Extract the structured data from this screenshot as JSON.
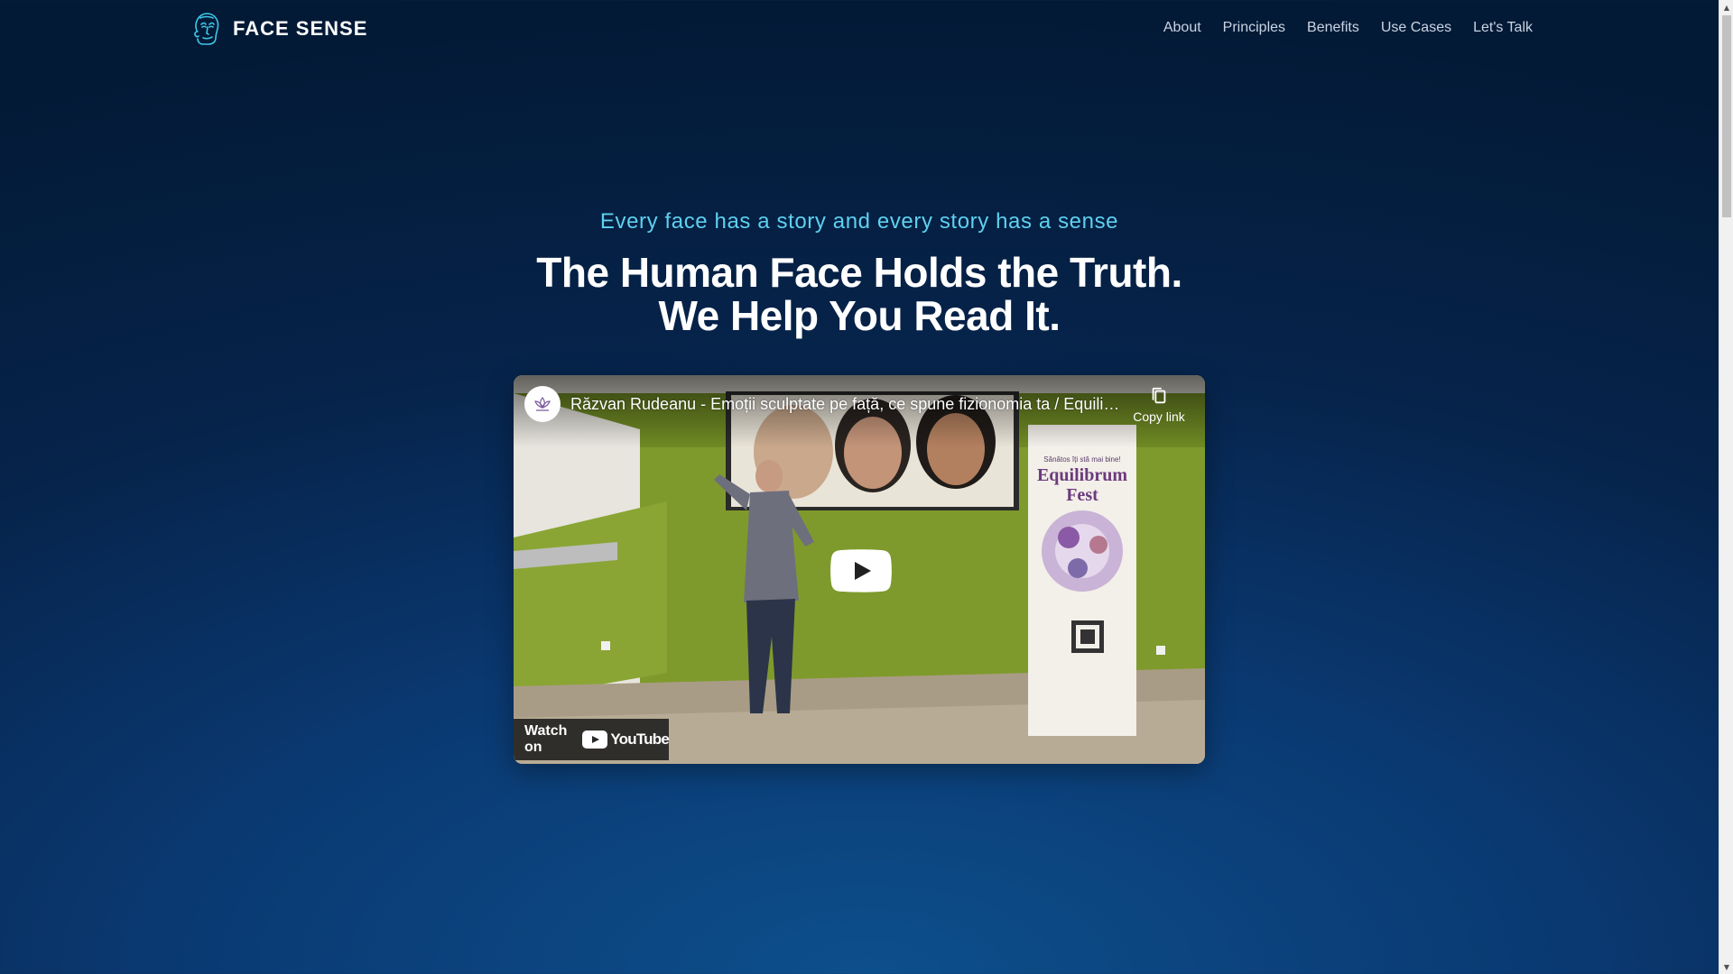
{
  "brand": {
    "name": "FACE SENSE"
  },
  "nav": {
    "items": [
      {
        "label": "About"
      },
      {
        "label": "Principles"
      },
      {
        "label": "Benefits"
      },
      {
        "label": "Use Cases"
      },
      {
        "label": "Let's Talk"
      }
    ]
  },
  "hero": {
    "tagline": "Every face has a story and every story has a sense",
    "headline_line1": "The Human Face Holds the Truth.",
    "headline_line2": "We Help You Read It."
  },
  "video": {
    "title": "Răzvan Rudeanu - Emoții sculptate pe față, ce spune fizionomia ta / Equilibrum Fest",
    "copy_link_label": "Copy link",
    "watch_on_label": "Watch on",
    "youtube_word": "YouTube",
    "banner_text_small": "Sănătos îți stă mai bine!",
    "banner_title_1": "Equilibrum",
    "banner_title_2": "Fest",
    "play_button_color": "#ffffff"
  },
  "colors": {
    "accent": "#5fd0f0",
    "background": "#06234a",
    "text": "#ffffff"
  }
}
